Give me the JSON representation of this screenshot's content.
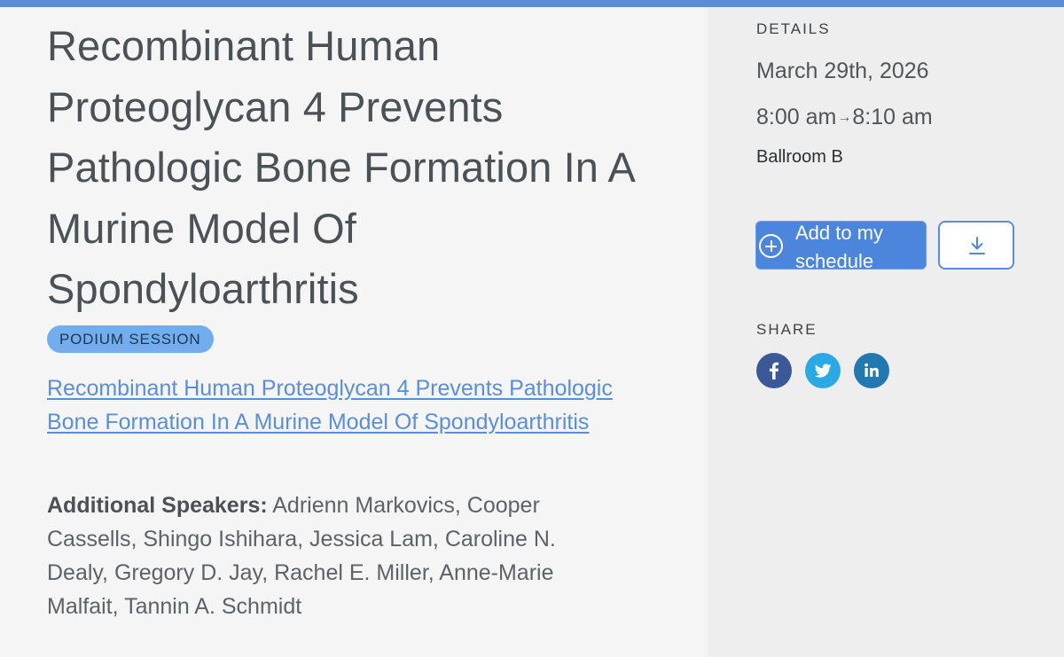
{
  "session": {
    "title": "Recombinant Human Proteoglycan 4 Prevents Pathologic Bone Formation In A Murine Model Of Spondyloarthritis",
    "badge": "PODIUM SESSION",
    "abstract_link": "Recombinant Human Proteoglycan 4 Prevents Pathologic Bone Formation In A Murine Model Of Spondyloarthritis",
    "speakers_label": "Additional Speakers:",
    "speakers": "Adrienn Markovics, Cooper Cassells, Shingo Ishihara, Jessica Lam, Caroline N. Dealy, Gregory D. Jay, Rachel E. Miller, Anne-Marie Malfait, Tannin A. Schmidt"
  },
  "details": {
    "label": "DETAILS",
    "date": "March 29th, 2026",
    "time_start": "8:00 am",
    "time_arrow": "→",
    "time_end": "8:10 am",
    "room": "Ballroom B",
    "add_button": "Add to my schedule",
    "add_icon": "plus-circle-icon",
    "download_icon": "download-icon"
  },
  "share": {
    "label": "SHARE",
    "networks": [
      "facebook-icon",
      "twitter-icon",
      "linkedin-icon"
    ]
  },
  "colors": {
    "accent": "#5b8ed6",
    "badge_bg": "#72aeee",
    "facebook": "#3b5998",
    "twitter": "#2aa9e6",
    "linkedin": "#2278b0"
  }
}
